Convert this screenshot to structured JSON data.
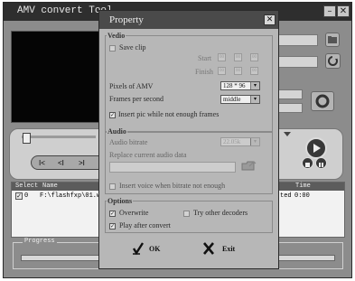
{
  "main": {
    "title": "AMV convert Tool",
    "min_glyph": "–",
    "close_glyph": "✕",
    "controls": [
      "I<",
      "<I",
      ">I"
    ],
    "list": {
      "col_select": "Select",
      "col_name": "Name",
      "col_time": "Time",
      "row": {
        "checked": "✓",
        "index": "0",
        "path": "F:\\flashfxp\\01.w",
        "status": "ted",
        "time": "0:00"
      }
    },
    "progress_label": "Progress"
  },
  "dialog": {
    "title": "Property",
    "close_glyph": "✕",
    "video": {
      "group": "Vedio",
      "save_clip": "Save clip",
      "start": "Start",
      "finish": "Finish",
      "time_fields": [
        "00",
        "00",
        "00"
      ],
      "pixels_label": "Pixels of AMV",
      "pixels_value": "128 * 96",
      "fps_label": "Frames per second",
      "fps_value": "middle",
      "insert_pic": "Insert pic while not enough frames"
    },
    "audio": {
      "group": "Audio",
      "bitrate_label": "Audio bitrate",
      "bitrate_value": "22.05k",
      "replace_label": "Replace current audio data",
      "insert_voice": "Insert voice when bitrate not enough"
    },
    "options": {
      "group": "Options",
      "overwrite": "Overwrite",
      "try_other": "Try other decoders",
      "play_after": "Play after convert"
    },
    "ok_label": "OK",
    "exit_label": "Exit",
    "checked_glyph": "✓",
    "arrow_glyph": "▾"
  }
}
